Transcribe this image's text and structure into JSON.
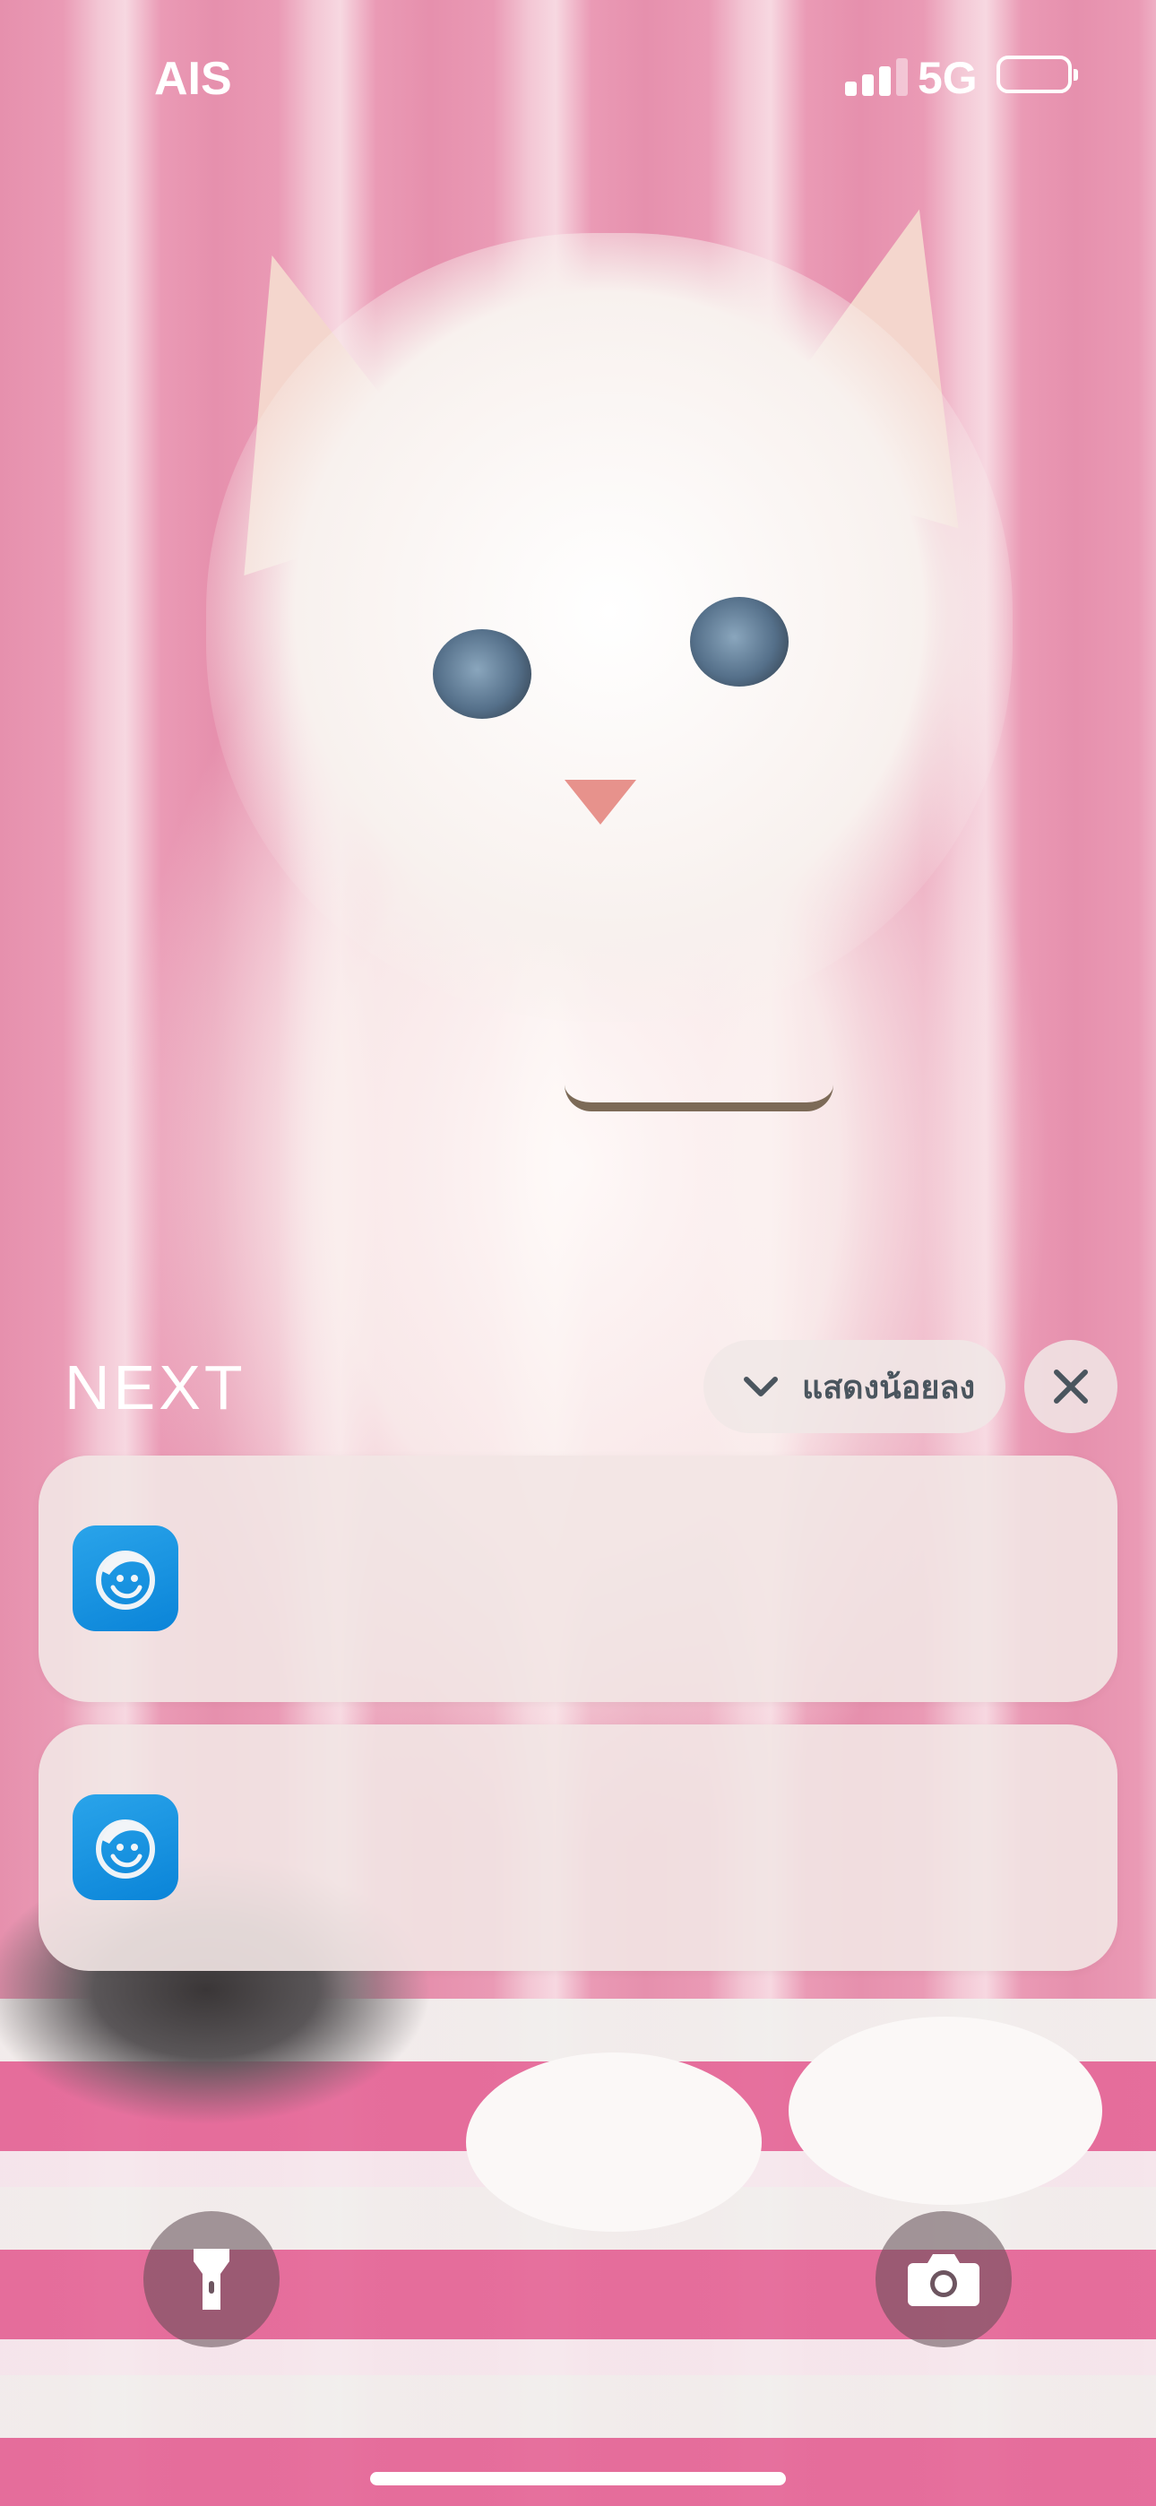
{
  "status_bar": {
    "carrier": "AIS",
    "network": "5G",
    "signal_icon": "cellular-signal-icon",
    "battery_icon": "battery-icon"
  },
  "notifications": {
    "section_label": "NEXT",
    "show_less_label": "แสดงน้อยลง",
    "show_less_icon": "chevron-down-icon",
    "clear_icon": "close-icon",
    "items": [
      {
        "app_icon": "krungthai-app-icon"
      },
      {
        "app_icon": "krungthai-app-icon"
      }
    ]
  },
  "quick_actions": {
    "left_icon": "flashlight-icon",
    "right_icon": "camera-icon"
  },
  "colors": {
    "wallpaper_pink": "#e690ad",
    "app_icon_blue": "#0a84d8",
    "button_label": "#4a555e"
  }
}
